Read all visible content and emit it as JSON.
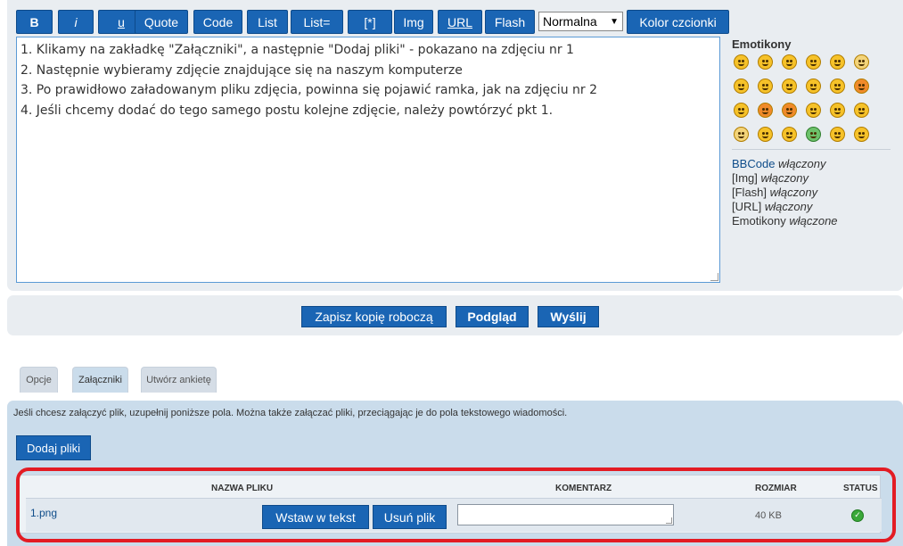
{
  "toolbar": {
    "buttons": [
      "B",
      "i",
      "u",
      "Quote",
      "Code",
      "List",
      "List=",
      "[*]",
      "Img",
      "URL",
      "Flash"
    ],
    "font_size_selected": "Normalna",
    "font_color_label": "Kolor czcionki"
  },
  "message": {
    "lines": [
      "1. Klikamy na zakładkę \"Załączniki\", a następnie \"Dodaj pliki\" - pokazano na zdjęciu nr 1",
      "2. Następnie wybieramy zdjęcie znajdujące się na naszym komputerze",
      "3. Po prawidłowo załadowanym pliku zdjęcia, powinna się pojawić ramka, jak na zdjęciu  nr 2",
      "4. Jeśli chcemy dodać do tego samego postu kolejne zdjęcie, należy powtórzyć pkt 1."
    ]
  },
  "smilies": {
    "title": "Emotikony",
    "icons": [
      "smile-icon",
      "grin-icon",
      "wink-icon",
      "confused-icon",
      "surprised-icon",
      "eek-icon",
      "sad-icon",
      "cool-icon",
      "laugh-icon",
      "razz-icon",
      "happy-icon",
      "mad-icon",
      "neutral-icon",
      "evil-icon",
      "twisted-icon",
      "rolleyes-icon",
      "exclaim-icon",
      "question-icon",
      "idea-icon",
      "arrow-icon",
      "mrgreen-icon",
      "geek-icon",
      "ugeek-icon",
      "shifty-icon"
    ]
  },
  "bbcode_status": [
    {
      "label": "BBCode",
      "value": "włączony"
    },
    {
      "label": "[Img]",
      "value": "włączony"
    },
    {
      "label": "[Flash]",
      "value": "włączony"
    },
    {
      "label": "[URL]",
      "value": "włączony"
    },
    {
      "label": "Emotikony",
      "value": "włączone"
    }
  ],
  "submit": {
    "save_draft": "Zapisz kopię roboczą",
    "preview": "Podgląd",
    "send": "Wyślij"
  },
  "tabs": [
    "Opcje",
    "Załączniki",
    "Utwórz ankietę"
  ],
  "attachments": {
    "hint": "Jeśli chcesz załączyć plik, uzupełnij poniższe pola. Można także załączać pliki, przeciągając je do pola tekstowego wiadomości.",
    "add_files": "Dodaj pliki",
    "columns": [
      "NAZWA PLIKU",
      "KOMENTARZ",
      "ROZMIAR",
      "STATUS"
    ],
    "file": {
      "name": "1.png",
      "insert_label": "Wstaw w tekst",
      "delete_label": "Usuń plik",
      "size": "40 KB",
      "status_icon": "check-icon",
      "comment_value": ""
    }
  },
  "colors": {
    "button": "#1a65b4",
    "panel": "#e9edf1",
    "attach_panel": "#cadceb",
    "highlight": "#e31b23"
  }
}
